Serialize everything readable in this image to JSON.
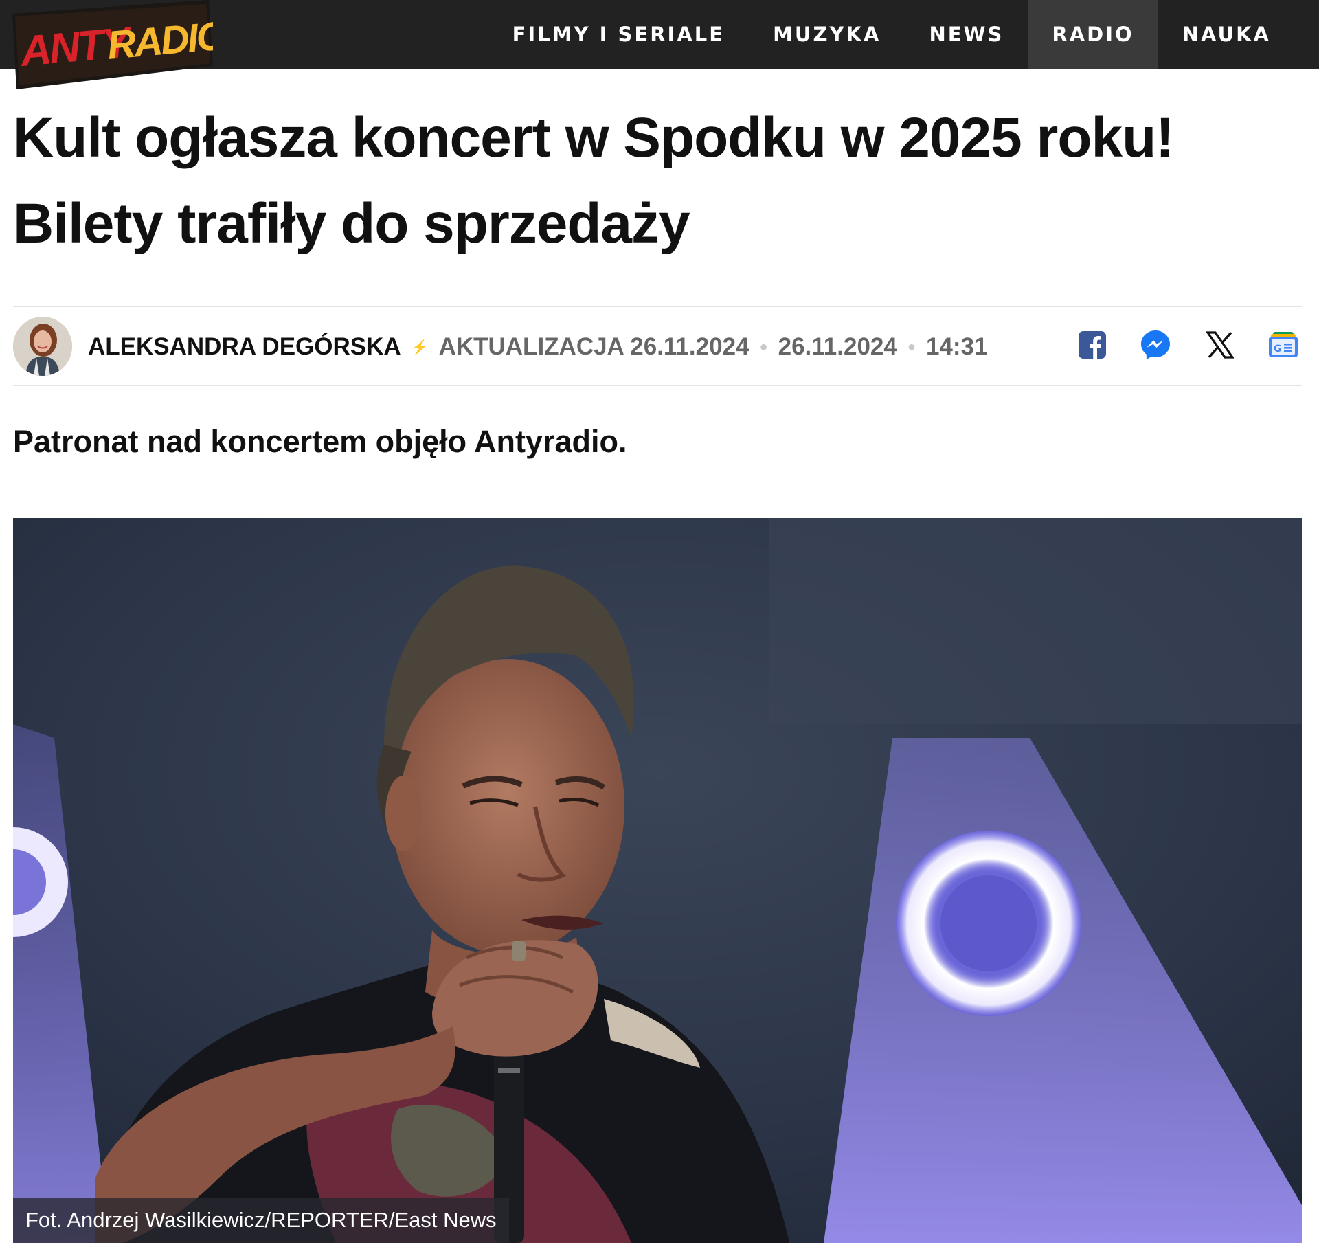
{
  "site": {
    "logo_text": "ANTYRADIO",
    "nav": [
      {
        "label": "FILMY I SERIALE",
        "active": false
      },
      {
        "label": "MUZYKA",
        "active": false
      },
      {
        "label": "NEWS",
        "active": false
      },
      {
        "label": "RADIO",
        "active": true
      },
      {
        "label": "NAUKA",
        "active": false
      }
    ]
  },
  "article": {
    "title_line1": "Kult ogłasza koncert w Spodku w 2025 roku!",
    "title_line2": "Bilety trafiły do sprzedaży",
    "author": "ALEKSANDRA DEGÓRSKA",
    "updated": "AKTUALIZACJA 26.11.2024",
    "published_date": "26.11.2024",
    "published_time": "14:31",
    "lead": "Patronat nad koncertem objęło Antyradio.",
    "image_caption": "Fot. Andrzej Wasilkiewicz/REPORTER/East News"
  },
  "share": [
    {
      "name": "facebook-icon",
      "color": "#3b5998"
    },
    {
      "name": "messenger-icon",
      "color": "#1877f2"
    },
    {
      "name": "x-icon",
      "color": "#111111"
    },
    {
      "name": "google-news-icon",
      "color": "#4285f4"
    }
  ],
  "colors": {
    "topbar": "#222222",
    "logo_red": "#d8232a",
    "logo_yellow": "#f5b82e"
  }
}
